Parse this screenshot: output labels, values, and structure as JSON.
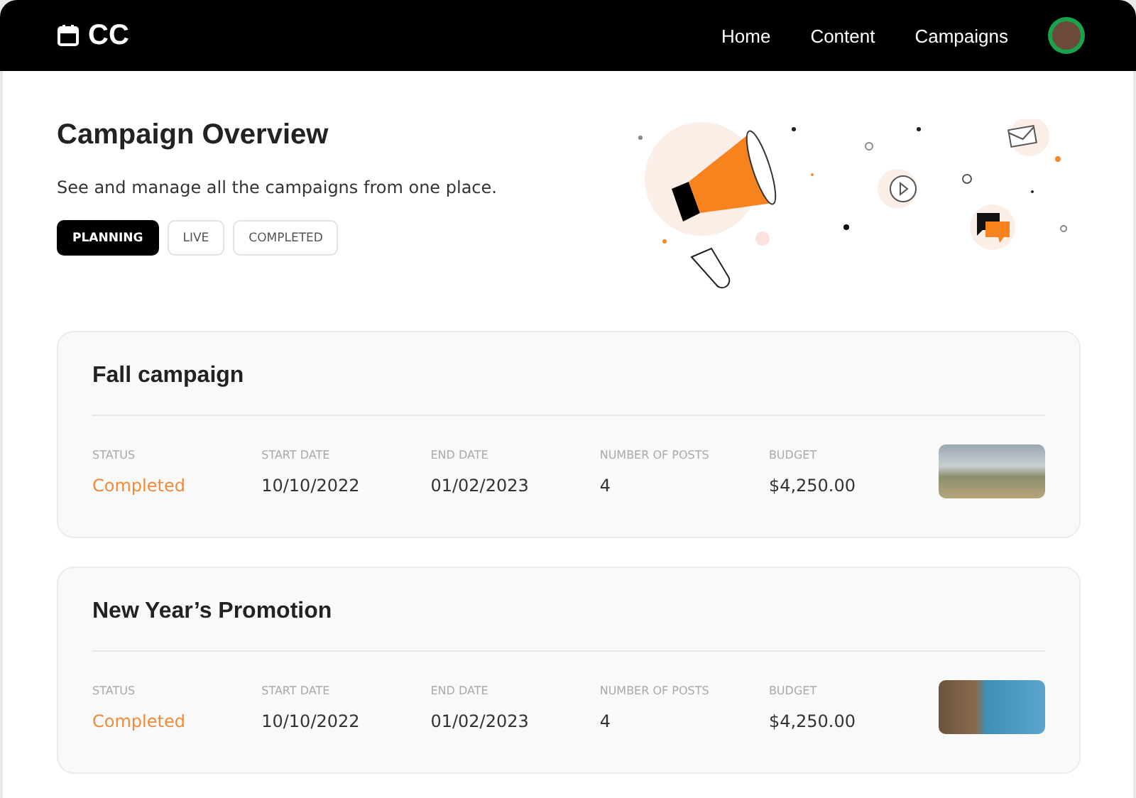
{
  "brand": {
    "name": "CC"
  },
  "nav": [
    {
      "label": "Home"
    },
    {
      "label": "Content"
    },
    {
      "label": "Campaigns"
    }
  ],
  "header": {
    "title": "Campaign Overview",
    "subtitle": "See and manage all the campaigns from one place."
  },
  "tabs": [
    {
      "label": "PLANNING",
      "selected": true
    },
    {
      "label": "LIVE",
      "selected": false
    },
    {
      "label": "COMPLETED",
      "selected": false
    }
  ],
  "campaigns": [
    {
      "title": "Fall campaign",
      "fields": [
        {
          "label": "STATUS",
          "value": "Completed",
          "kind": "status"
        },
        {
          "label": "START DATE",
          "value": "10/10/2022",
          "kind": "text"
        },
        {
          "label": "END DATE",
          "value": "01/02/2023",
          "kind": "text"
        },
        {
          "label": "NUMBER OF POSTS",
          "value": "4",
          "kind": "text"
        },
        {
          "label": "BUDGET",
          "value": "$4,250.00",
          "kind": "text"
        }
      ]
    },
    {
      "title": "New Year’s Promotion",
      "fields": [
        {
          "label": "STATUS",
          "value": "Completed",
          "kind": "status"
        },
        {
          "label": "START DATE",
          "value": "10/10/2022",
          "kind": "text"
        },
        {
          "label": "END DATE",
          "value": "01/02/2023",
          "kind": "text"
        },
        {
          "label": "NUMBER OF POSTS",
          "value": "4",
          "kind": "text"
        },
        {
          "label": "BUDGET",
          "value": "$4,250.00",
          "kind": "text"
        }
      ]
    }
  ]
}
